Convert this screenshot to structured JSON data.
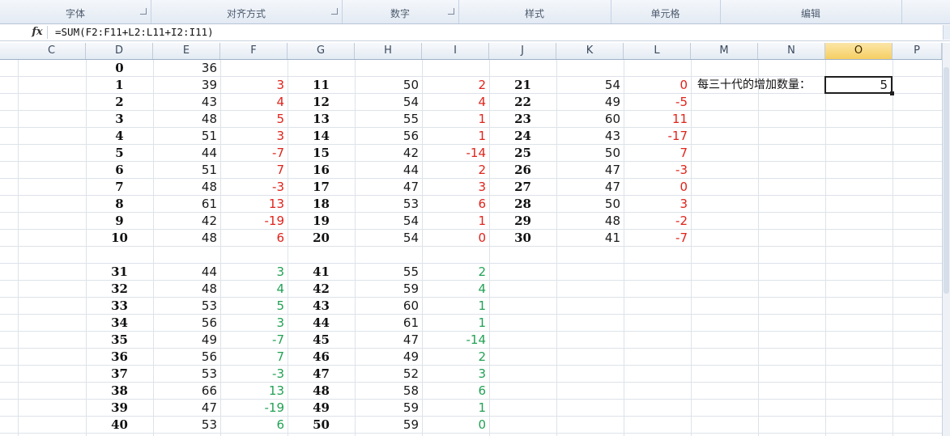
{
  "ribbon": {
    "groups": [
      {
        "label": "字体"
      },
      {
        "label": "对齐方式"
      },
      {
        "label": "数字"
      },
      {
        "label": "样式"
      },
      {
        "label": "单元格"
      },
      {
        "label": "编辑"
      }
    ]
  },
  "formula_bar": {
    "fx": "fx",
    "formula": "=SUM(F2:F11+L2:L11+I2:I11)"
  },
  "columns": [
    "C",
    "D",
    "E",
    "F",
    "G",
    "H",
    "I",
    "J",
    "K",
    "L",
    "M",
    "N",
    "O",
    "P"
  ],
  "selected_column": "O",
  "top_block": {
    "rows": [
      {
        "D": "0",
        "E": "36",
        "F": "",
        "G": "",
        "H": "",
        "I": "",
        "J": "",
        "K": "",
        "L": ""
      },
      {
        "D": "1",
        "E": "39",
        "F": "3",
        "G": "11",
        "H": "50",
        "I": "2",
        "J": "21",
        "K": "54",
        "L": "0"
      },
      {
        "D": "2",
        "E": "43",
        "F": "4",
        "G": "12",
        "H": "54",
        "I": "4",
        "J": "22",
        "K": "49",
        "L": "-5"
      },
      {
        "D": "3",
        "E": "48",
        "F": "5",
        "G": "13",
        "H": "55",
        "I": "1",
        "J": "23",
        "K": "60",
        "L": "11"
      },
      {
        "D": "4",
        "E": "51",
        "F": "3",
        "G": "14",
        "H": "56",
        "I": "1",
        "J": "24",
        "K": "43",
        "L": "-17"
      },
      {
        "D": "5",
        "E": "44",
        "F": "-7",
        "G": "15",
        "H": "42",
        "I": "-14",
        "J": "25",
        "K": "50",
        "L": "7"
      },
      {
        "D": "6",
        "E": "51",
        "F": "7",
        "G": "16",
        "H": "44",
        "I": "2",
        "J": "26",
        "K": "47",
        "L": "-3"
      },
      {
        "D": "7",
        "E": "48",
        "F": "-3",
        "G": "17",
        "H": "47",
        "I": "3",
        "J": "27",
        "K": "47",
        "L": "0"
      },
      {
        "D": "8",
        "E": "61",
        "F": "13",
        "G": "18",
        "H": "53",
        "I": "6",
        "J": "28",
        "K": "50",
        "L": "3"
      },
      {
        "D": "9",
        "E": "42",
        "F": "-19",
        "G": "19",
        "H": "54",
        "I": "1",
        "J": "29",
        "K": "48",
        "L": "-2"
      },
      {
        "D": "10",
        "E": "48",
        "F": "6",
        "G": "20",
        "H": "54",
        "I": "0",
        "J": "30",
        "K": "41",
        "L": "-7"
      }
    ]
  },
  "bottom_block": {
    "rows": [
      {
        "D": "31",
        "E": "44",
        "F": "3",
        "G": "41",
        "H": "55",
        "I": "2"
      },
      {
        "D": "32",
        "E": "48",
        "F": "4",
        "G": "42",
        "H": "59",
        "I": "4"
      },
      {
        "D": "33",
        "E": "53",
        "F": "5",
        "G": "43",
        "H": "60",
        "I": "1"
      },
      {
        "D": "34",
        "E": "56",
        "F": "3",
        "G": "44",
        "H": "61",
        "I": "1"
      },
      {
        "D": "35",
        "E": "49",
        "F": "-7",
        "G": "45",
        "H": "47",
        "I": "-14"
      },
      {
        "D": "36",
        "E": "56",
        "F": "7",
        "G": "46",
        "H": "49",
        "I": "2"
      },
      {
        "D": "37",
        "E": "53",
        "F": "-3",
        "G": "47",
        "H": "52",
        "I": "3"
      },
      {
        "D": "38",
        "E": "66",
        "F": "13",
        "G": "48",
        "H": "58",
        "I": "6"
      },
      {
        "D": "39",
        "E": "47",
        "F": "-19",
        "G": "49",
        "H": "59",
        "I": "1"
      },
      {
        "D": "40",
        "E": "53",
        "F": "6",
        "G": "50",
        "H": "59",
        "I": "0"
      }
    ]
  },
  "summary": {
    "label": "每三十代的增加数量：",
    "value": "5"
  },
  "colors": {
    "diff_top": "#e0231b",
    "diff_bottom": "#22a155",
    "selected_header": "#f6cf63"
  }
}
